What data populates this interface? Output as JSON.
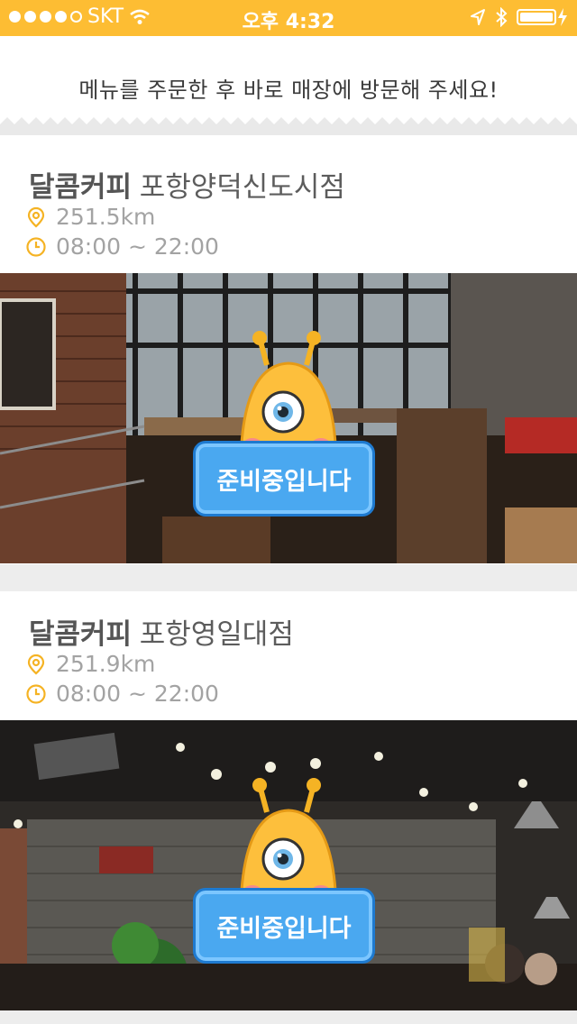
{
  "status_bar": {
    "carrier": "SKT",
    "time": "오후 4:32"
  },
  "notice": {
    "text": "메뉴를 주문한 후 바로 매장에 방문해 주세요!"
  },
  "stores": [
    {
      "brand": "달콤커피",
      "branch": "포항양덕신도시점",
      "distance": "251.5km",
      "hours": "08:00 ~ 22:00",
      "status_badge": "준비중입니다"
    },
    {
      "brand": "달콤커피",
      "branch": "포항영일대점",
      "distance": "251.9km",
      "hours": "08:00 ~ 22:00",
      "status_badge": "준비중입니다"
    }
  ],
  "colors": {
    "accent": "#fdbd33",
    "badge": "#4aa8f0",
    "text": "#5c5c5c",
    "muted": "#a3a3a3"
  },
  "icons": [
    "wifi-icon",
    "location-arrow-icon",
    "bluetooth-icon",
    "battery-icon",
    "map-pin-icon",
    "clock-icon"
  ]
}
